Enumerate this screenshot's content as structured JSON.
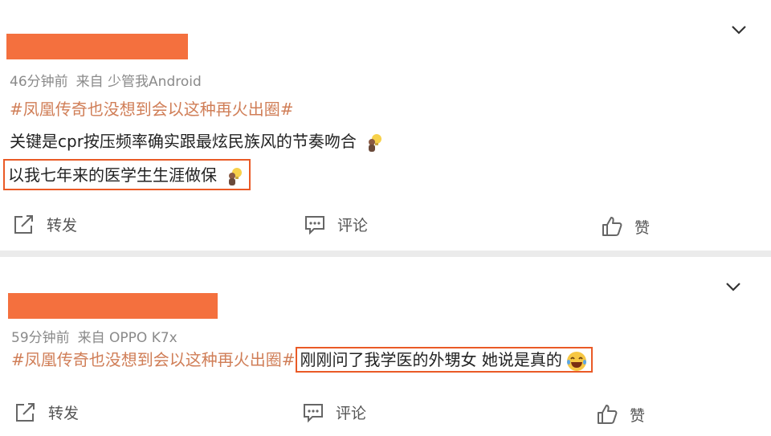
{
  "posts": [
    {
      "meta_time": "46分钟前",
      "meta_source": "来自 少管我Android",
      "topic": "#凤凰传奇也没想到会以这种再火出圈#",
      "line1": "关键是cpr按压频率确实跟最炫民族风的节奏吻合",
      "line2": "以我七年来的医学生生涯做保",
      "emoji1": "lightbulb-person-emoji",
      "emoji2": "lightbulb-person-emoji",
      "actions": {
        "repost": "转发",
        "comment": "评论",
        "like": "赞"
      }
    },
    {
      "meta_time": "59分钟前",
      "meta_source": "来自 OPPO K7x",
      "topic": "#凤凰传奇也没想到会以这种再火出圈#",
      "text": "刚刚问了我学医的外甥女 她说是真的",
      "emoji": "laughing-tears-emoji",
      "actions": {
        "repost": "转发",
        "comment": "评论",
        "like": "赞"
      }
    }
  ],
  "colors": {
    "redaction": "#f4703e",
    "highlight_box": "#ea5a26",
    "topic": "#d07e57",
    "meta": "#8a8a8a",
    "background": "#ebebeb"
  }
}
